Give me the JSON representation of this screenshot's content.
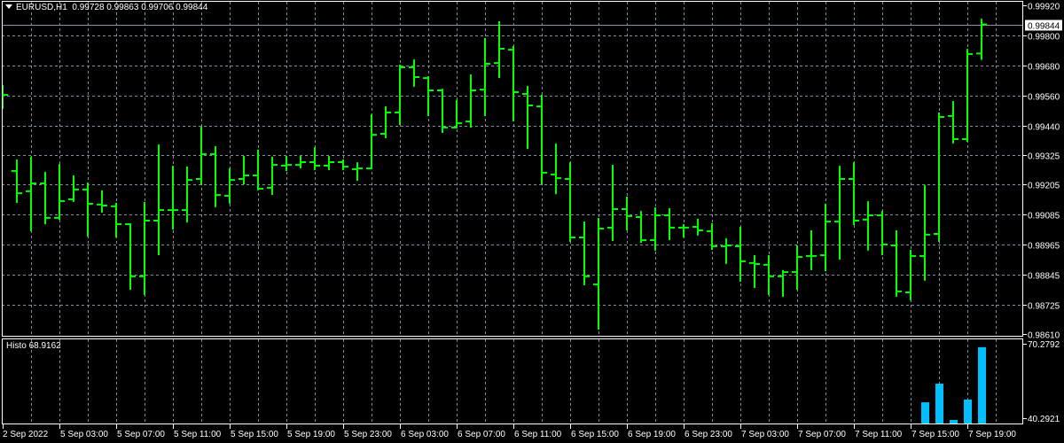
{
  "header": {
    "symbol_timeframe": "EURUSD,H1",
    "ohlc_text": "0.99728 0.99863 0.99706 0.99844"
  },
  "indicator": {
    "label": "Histo",
    "value": "68.9162"
  },
  "colors": {
    "background": "#000000",
    "bar": "#00ff00",
    "histogram": "#00bfff",
    "grid": "#8090a0",
    "axis": "#ffffff"
  },
  "chart_data": [
    {
      "type": "ohlc",
      "title": "EURUSD,H1",
      "current_price": "0.99844",
      "ylim": [
        0.9861,
        0.9992
      ],
      "y_ticks": [
        "0.99920",
        "0.99800",
        "0.99680",
        "0.99560",
        "0.99440",
        "0.99325",
        "0.99205",
        "0.99085",
        "0.98965",
        "0.98845",
        "0.98725",
        "0.98610"
      ],
      "x_ticks": [
        "2 Sep 2022",
        "5 Sep 03:00",
        "5 Sep 07:00",
        "5 Sep 11:00",
        "5 Sep 15:00",
        "5 Sep 19:00",
        "5 Sep 23:00",
        "6 Sep 03:00",
        "6 Sep 07:00",
        "6 Sep 11:00",
        "6 Sep 15:00",
        "6 Sep 19:00",
        "6 Sep 23:00",
        "7 Sep 03:00",
        "7 Sep 07:00",
        "7 Sep 11:00",
        "7 Sep 15:00",
        "7 Sep 19:00"
      ],
      "grid": true,
      "bars_ohlc": [
        [
          0.99563,
          0.99599,
          0.9951,
          0.99563
        ],
        [
          0.9926,
          0.99302,
          0.99136,
          0.99171
        ],
        [
          0.99179,
          0.99313,
          0.99023,
          0.9921
        ],
        [
          0.9921,
          0.99253,
          0.99051,
          0.99073
        ],
        [
          0.99073,
          0.99284,
          0.99069,
          0.9914
        ],
        [
          0.99147,
          0.99239,
          0.9914,
          0.99186
        ],
        [
          0.99186,
          0.9921,
          0.99002,
          0.99129
        ],
        [
          0.99126,
          0.99179,
          0.99097,
          0.99122
        ],
        [
          0.99119,
          0.99129,
          0.98998,
          0.99048
        ],
        [
          0.99048,
          0.99048,
          0.9879,
          0.9884
        ],
        [
          0.9884,
          0.99133,
          0.98769,
          0.99062
        ],
        [
          0.99062,
          0.99362,
          0.98928,
          0.99104
        ],
        [
          0.99104,
          0.99277,
          0.9903,
          0.99104
        ],
        [
          0.99104,
          0.99274,
          0.99058,
          0.99224
        ],
        [
          0.99228,
          0.99433,
          0.99207,
          0.99327
        ],
        [
          0.99327,
          0.99355,
          0.99119,
          0.99164
        ],
        [
          0.99161,
          0.99267,
          0.99133,
          0.99224
        ],
        [
          0.99228,
          0.99316,
          0.9921,
          0.99242
        ],
        [
          0.99242,
          0.99341,
          0.99186,
          0.99189
        ],
        [
          0.99193,
          0.99313,
          0.99168,
          0.99284
        ],
        [
          0.99281,
          0.99316,
          0.99263,
          0.99284
        ],
        [
          0.99284,
          0.99316,
          0.99274,
          0.99295
        ],
        [
          0.99295,
          0.99351,
          0.99267,
          0.99281
        ],
        [
          0.99281,
          0.99316,
          0.99267,
          0.99295
        ],
        [
          0.99295,
          0.99302,
          0.99267,
          0.99277
        ],
        [
          0.99267,
          0.99291,
          0.99224,
          0.9927
        ],
        [
          0.9927,
          0.99482,
          0.9927,
          0.99404
        ],
        [
          0.99408,
          0.99514,
          0.99394,
          0.99493
        ],
        [
          0.99493,
          0.9968,
          0.99447,
          0.99673
        ],
        [
          0.99673,
          0.99701,
          0.99599,
          0.99634
        ],
        [
          0.9963,
          0.99634,
          0.99482,
          0.99581
        ],
        [
          0.99581,
          0.99584,
          0.99415,
          0.99433
        ],
        [
          0.99433,
          0.99539,
          0.99433,
          0.9945
        ],
        [
          0.99457,
          0.99641,
          0.99436,
          0.99581
        ],
        [
          0.99584,
          0.99786,
          0.99482,
          0.99687
        ],
        [
          0.9969,
          0.99853,
          0.99634,
          0.99747
        ],
        [
          0.99743,
          0.99754,
          0.99461,
          0.99574
        ],
        [
          0.99567,
          0.99595,
          0.99351,
          0.99521
        ],
        [
          0.99517,
          0.9956,
          0.9921,
          0.99253
        ],
        [
          0.99246,
          0.99366,
          0.99171,
          0.99231
        ],
        [
          0.99228,
          0.99291,
          0.98981,
          0.98995
        ],
        [
          0.98995,
          0.99055,
          0.98808,
          0.9884
        ],
        [
          0.98808,
          0.99069,
          0.98631,
          0.9903
        ],
        [
          0.99034,
          0.99281,
          0.98984,
          0.99108
        ],
        [
          0.99108,
          0.99154,
          0.99027,
          0.9908
        ],
        [
          0.99076,
          0.99097,
          0.98977,
          0.98984
        ],
        [
          0.98984,
          0.99111,
          0.98946,
          0.99083
        ],
        [
          0.99083,
          0.99108,
          0.98988,
          0.99034
        ],
        [
          0.99034,
          0.99044,
          0.98998,
          0.99034
        ],
        [
          0.99037,
          0.99066,
          0.99006,
          0.99023
        ],
        [
          0.9902,
          0.99048,
          0.98949,
          0.9896
        ],
        [
          0.9896,
          0.98988,
          0.98893,
          0.98963
        ],
        [
          0.9896,
          0.99034,
          0.98822,
          0.989
        ],
        [
          0.98893,
          0.98921,
          0.98797,
          0.98889
        ],
        [
          0.98886,
          0.98921,
          0.98769,
          0.9884
        ],
        [
          0.9884,
          0.98861,
          0.98762,
          0.98857
        ],
        [
          0.98857,
          0.9896,
          0.9879,
          0.98917
        ],
        [
          0.98921,
          0.9902,
          0.98868,
          0.98921
        ],
        [
          0.98924,
          0.99126,
          0.98864,
          0.99058
        ],
        [
          0.99058,
          0.99277,
          0.9891,
          0.99228
        ],
        [
          0.99228,
          0.99291,
          0.99048,
          0.99062
        ],
        [
          0.99066,
          0.99136,
          0.98946,
          0.99083
        ],
        [
          0.99083,
          0.99097,
          0.98928,
          0.98967
        ],
        [
          0.98963,
          0.9902,
          0.98762,
          0.9878
        ],
        [
          0.98776,
          0.98942,
          0.98748,
          0.98921
        ],
        [
          0.98921,
          0.992,
          0.98826,
          0.99006
        ],
        [
          0.99009,
          0.99489,
          0.98981,
          0.99475
        ],
        [
          0.99479,
          0.99535,
          0.99373,
          0.99387
        ],
        [
          0.99387,
          0.99743,
          0.9938,
          0.99726
        ],
        [
          0.99728,
          0.99863,
          0.99706,
          0.99844
        ]
      ]
    },
    {
      "type": "bar",
      "title": "Histo",
      "ylim": [
        40.2921,
        70.2792
      ],
      "y_ticks": [
        "70.2792",
        "40.2921"
      ],
      "start_bar_index": 65,
      "values": [
        46.7,
        54.2,
        39.6,
        47.8,
        68.9162
      ]
    }
  ]
}
